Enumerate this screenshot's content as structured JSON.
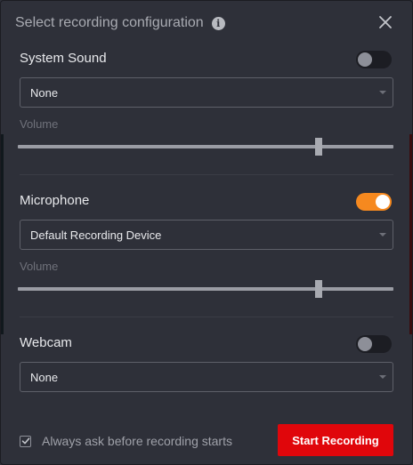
{
  "dialog": {
    "title": "Select recording configuration",
    "info_glyph": "i"
  },
  "sections": {
    "system_sound": {
      "label": "System Sound",
      "enabled": false,
      "source": "None",
      "volume_label": "Volume",
      "volume_percent": 80
    },
    "microphone": {
      "label": "Microphone",
      "enabled": true,
      "source": "Default Recording Device",
      "volume_label": "Volume",
      "volume_percent": 80
    },
    "webcam": {
      "label": "Webcam",
      "enabled": false,
      "source": "None"
    }
  },
  "footer": {
    "always_ask_label": "Always ask before recording starts",
    "always_ask_checked": true,
    "start_label": "Start Recording"
  },
  "colors": {
    "background": "#2e3039",
    "toggle_on": "#f6891f",
    "start_button": "#e0060b"
  },
  "icons": {
    "info": "info-icon",
    "close": "close-icon",
    "dropdown": "chevron-down-icon",
    "check": "check-icon"
  }
}
